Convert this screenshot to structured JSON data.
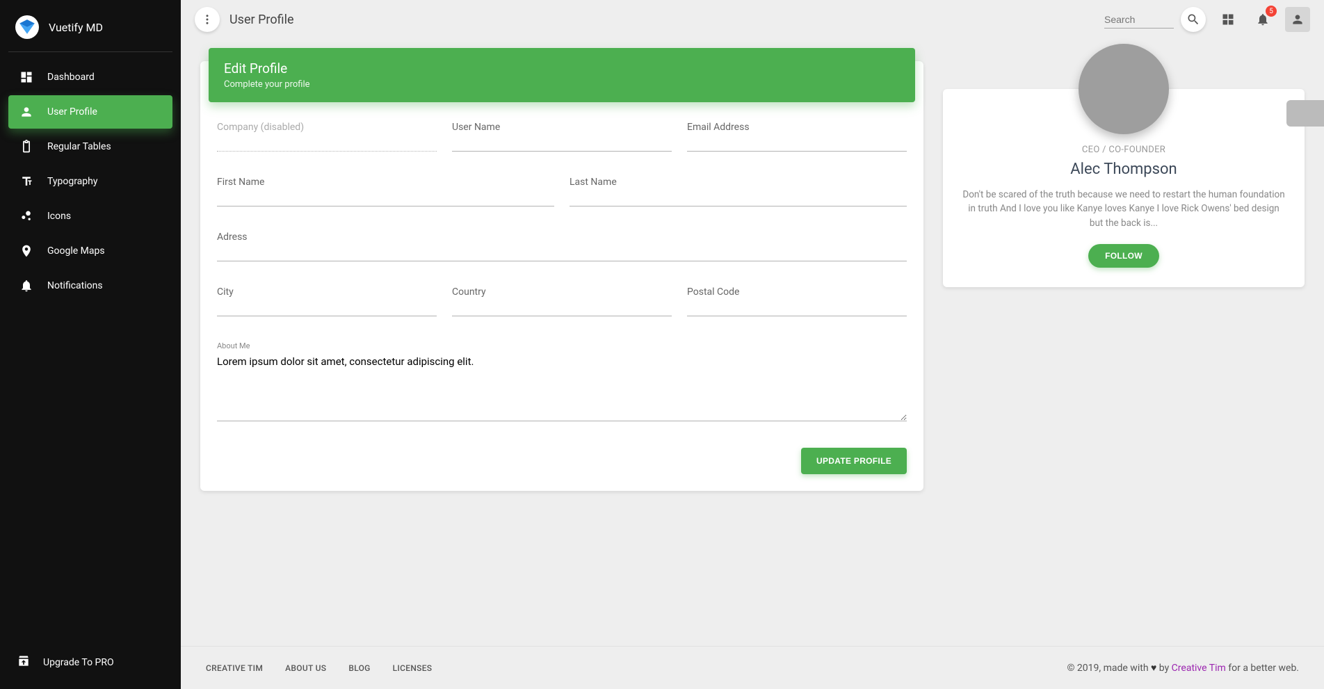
{
  "brand": {
    "title": "Vuetify MD"
  },
  "sidebar": {
    "items": [
      {
        "label": "Dashboard",
        "icon": "dashboard"
      },
      {
        "label": "User Profile",
        "icon": "person",
        "active": true
      },
      {
        "label": "Regular Tables",
        "icon": "clipboard"
      },
      {
        "label": "Typography",
        "icon": "typography"
      },
      {
        "label": "Icons",
        "icon": "bubble"
      },
      {
        "label": "Google Maps",
        "icon": "location"
      },
      {
        "label": "Notifications",
        "icon": "bell"
      }
    ],
    "upgrade_label": "Upgrade To PRO"
  },
  "header": {
    "title": "User Profile",
    "search_placeholder": "Search",
    "notification_count": "5"
  },
  "form": {
    "title": "Edit Profile",
    "subtitle": "Complete your profile",
    "labels": {
      "company": "Company (disabled)",
      "username": "User Name",
      "email": "Email Address",
      "first_name": "First Name",
      "last_name": "Last Name",
      "address": "Adress",
      "city": "City",
      "country": "Country",
      "postal": "Postal Code",
      "about": "About Me"
    },
    "values": {
      "about": "Lorem ipsum dolor sit amet, consectetur adipiscing elit."
    },
    "submit_label": "UPDATE PROFILE"
  },
  "profile": {
    "role": "CEO / CO-FOUNDER",
    "name": "Alec Thompson",
    "bio": "Don't be scared of the truth because we need to restart the human foundation in truth And I love you like Kanye loves Kanye I love Rick Owens' bed design but the back is...",
    "follow_label": "FOLLOW"
  },
  "footer": {
    "links": [
      "CREATIVE TIM",
      "ABOUT US",
      "BLOG",
      "LICENSES"
    ],
    "copyright_prefix": "© 2019, made with ",
    "copyright_by": " by ",
    "credit": "Creative Tim",
    "copyright_suffix": " for a better web."
  }
}
